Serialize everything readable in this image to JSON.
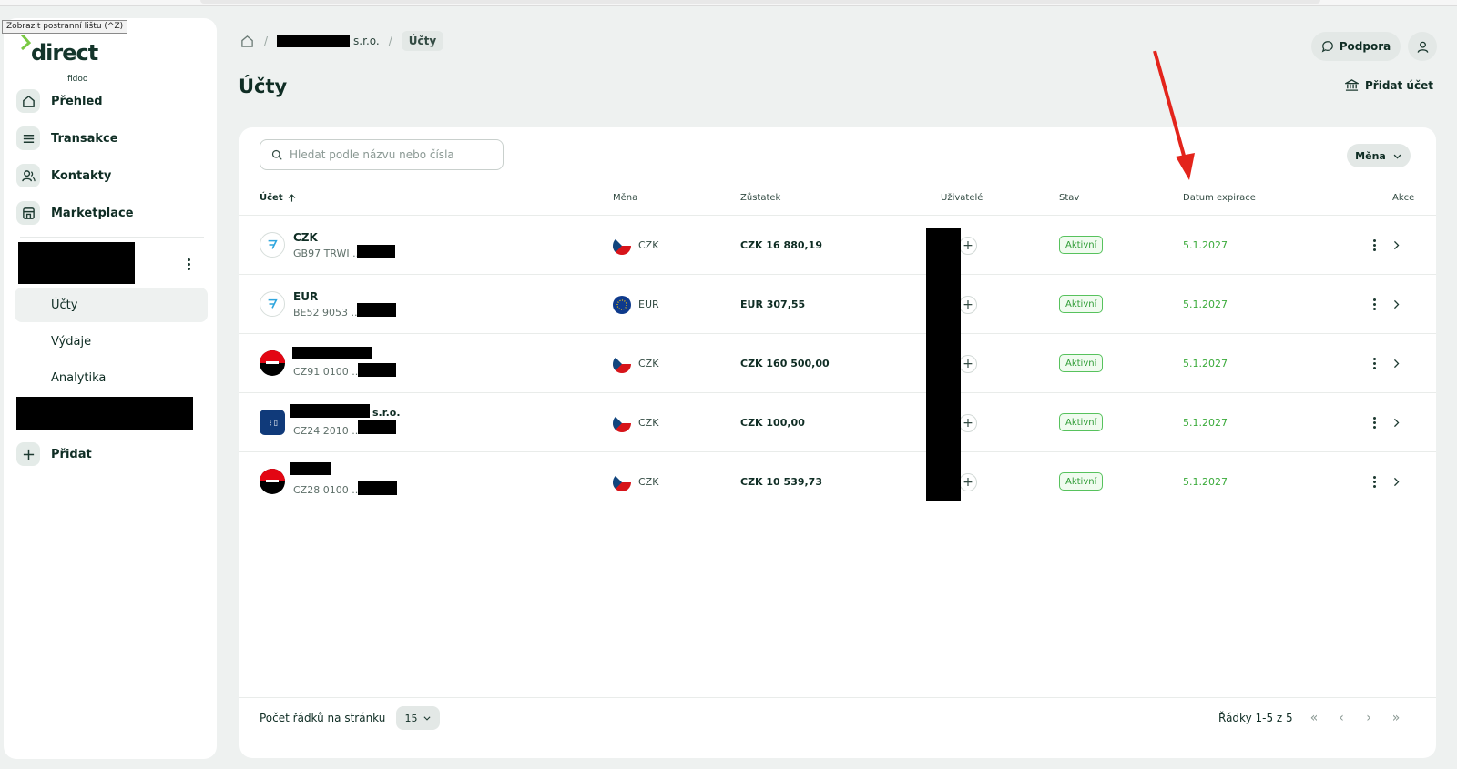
{
  "tooltip": "Zobrazit postranní lištu (^Z)",
  "logo": {
    "word": "direct",
    "sub": "fidoo"
  },
  "sidebar": {
    "nav": [
      {
        "label": "Přehled",
        "icon": "home-icon"
      },
      {
        "label": "Transakce",
        "icon": "list-icon"
      },
      {
        "label": "Kontakty",
        "icon": "contacts-icon"
      },
      {
        "label": "Marketplace",
        "icon": "marketplace-icon"
      }
    ],
    "sub_items": [
      {
        "label": "Účty",
        "active": true
      },
      {
        "label": "Výdaje",
        "active": false
      },
      {
        "label": "Analytika",
        "active": false
      }
    ],
    "add_label": "Přidat"
  },
  "breadcrumb": {
    "company_suffix": "s.r.o.",
    "current": "Účty"
  },
  "page_title": "Účty",
  "header": {
    "support_label": "Podpora",
    "add_account_label": "Přidat účet"
  },
  "toolbar": {
    "search_placeholder": "Hledat podle názvu nebo čísla",
    "currency_filter_label": "Měna"
  },
  "table": {
    "columns": {
      "account": "Účet",
      "currency": "Měna",
      "balance": "Zůstatek",
      "users": "Uživatelé",
      "status": "Stav",
      "expiry": "Datum expirace",
      "actions": "Akce"
    },
    "rows": [
      {
        "logo": "wise",
        "name": "CZK",
        "number": "GB97 TRWI ...",
        "currency": "CZK",
        "flag": "cz",
        "balance": "CZK 16 880,19",
        "status": "Aktivní",
        "expiry": "5.1.2027"
      },
      {
        "logo": "wise",
        "name": "EUR",
        "number": "BE52 9053 ...",
        "currency": "EUR",
        "flag": "eu",
        "balance": "EUR 307,55",
        "status": "Aktivní",
        "expiry": "5.1.2027"
      },
      {
        "logo": "kb",
        "name": "",
        "number": "CZ91 0100 ...",
        "currency": "CZK",
        "flag": "cz",
        "balance": "CZK 160 500,00",
        "status": "Aktivní",
        "expiry": "5.1.2027"
      },
      {
        "logo": "fio",
        "name": "s.r.o.",
        "number": "CZ24 2010 ...",
        "currency": "CZK",
        "flag": "cz",
        "balance": "CZK 100,00",
        "status": "Aktivní",
        "expiry": "5.1.2027"
      },
      {
        "logo": "kb",
        "name": "",
        "number": "CZ28 0100 ...",
        "currency": "CZK",
        "flag": "cz",
        "balance": "CZK 10 539,73",
        "status": "Aktivní",
        "expiry": "5.1.2027"
      }
    ]
  },
  "footer": {
    "rows_per_page_label": "Počet řádků na stránku",
    "rows_per_page_value": "15",
    "range_label": "Řádky 1-5 z 5"
  },
  "colors": {
    "accent_green": "#3aaa3a",
    "annotation_red": "#e3241b",
    "dark_text": "#0f2d24"
  }
}
